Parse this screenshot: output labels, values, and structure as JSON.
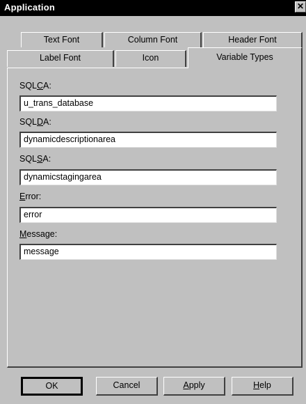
{
  "window": {
    "title": "Application",
    "close_glyph": "✕"
  },
  "tabs": {
    "back_row": [
      "Text Font",
      "Column Font",
      "Header Font"
    ],
    "front_row": [
      "Label Font",
      "Icon",
      "Variable Types"
    ],
    "active": "Variable Types"
  },
  "fields": [
    {
      "label": "SQLCA:",
      "value": "u_trans_database"
    },
    {
      "label": "SQLDA:",
      "value": "dynamicdescriptionarea"
    },
    {
      "label": "SQLSA:",
      "value": "dynamicstagingarea"
    },
    {
      "label": "Error:",
      "value": "error"
    },
    {
      "label": "Message:",
      "value": "message"
    }
  ],
  "buttons": {
    "ok": "OK",
    "cancel": "Cancel",
    "apply": "Apply",
    "help": "Help"
  }
}
